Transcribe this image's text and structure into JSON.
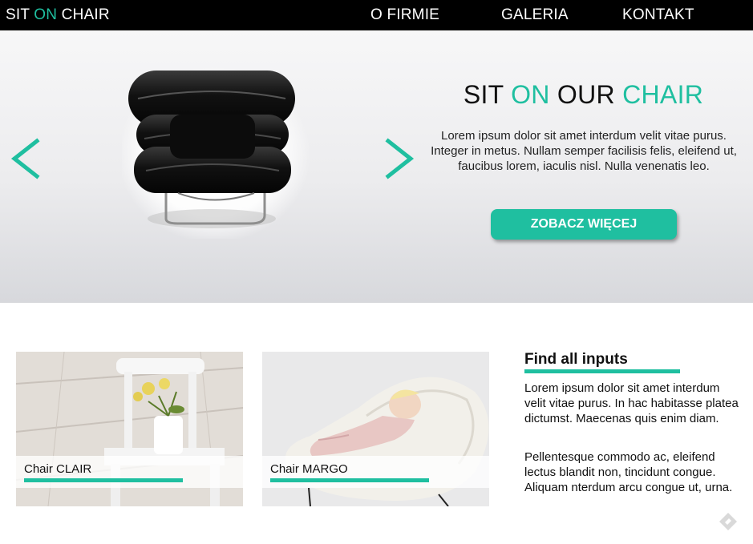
{
  "navbar": {
    "logo": {
      "part1": "SIT ",
      "part2": "ON",
      "part3": " CHAIR"
    },
    "links": [
      "O FIRMIE",
      "GALERIA",
      "KONTAKT"
    ]
  },
  "hero": {
    "title": {
      "part1": "SIT ",
      "part2": "ON",
      "part3": " OUR ",
      "part4": "CHAIR"
    },
    "text": "Lorem ipsum dolor sit amet interdum velit vitae purus. Integer in metus. Nullam semper facilisis felis, eleifend ut, faucibus lorem, iaculis nisl. Nulla venenatis leo.",
    "button_label": "ZOBACZ WIĘCEJ",
    "prev_icon": "chevron-left-icon",
    "next_icon": "chevron-right-icon"
  },
  "products": [
    {
      "label": "Chair CLAIR"
    },
    {
      "label": "Chair MARGO"
    }
  ],
  "side": {
    "title": "Find all inputs",
    "paragraph1": "Lorem ipsum dolor sit amet interdum velit vitae purus. In hac habitasse platea dictumst. Maecenas quis enim diam.",
    "paragraph2": "Pellentesque commodo ac, eleifend lectus blandit non, tincidunt congue. Aliquam nterdum arcu congue ut, urna."
  },
  "colors": {
    "accent": "#1fbfa0",
    "nav_bg": "#000000"
  }
}
